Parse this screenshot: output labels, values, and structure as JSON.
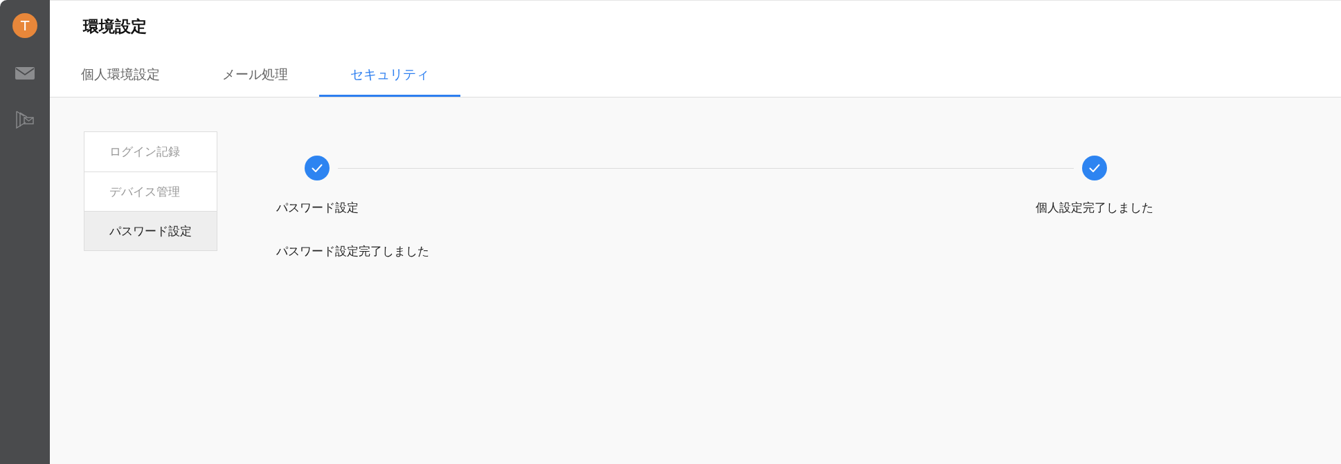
{
  "sidebar": {
    "avatar_initial": "T"
  },
  "header": {
    "title": "環境設定"
  },
  "tabs": [
    {
      "label": "個人環境設定",
      "selected": false
    },
    {
      "label": "メール処理",
      "selected": false
    },
    {
      "label": "セキュリティ",
      "selected": true
    }
  ],
  "security_menu": [
    {
      "label": "ログイン記録",
      "selected": false
    },
    {
      "label": "デバイス管理",
      "selected": false
    },
    {
      "label": "パスワード設定",
      "selected": true
    }
  ],
  "steps": [
    {
      "label": "パスワード設定",
      "completed": true
    },
    {
      "label": "個人設定完了しました",
      "completed": true
    }
  ],
  "message": "パスワード設定完了しました"
}
